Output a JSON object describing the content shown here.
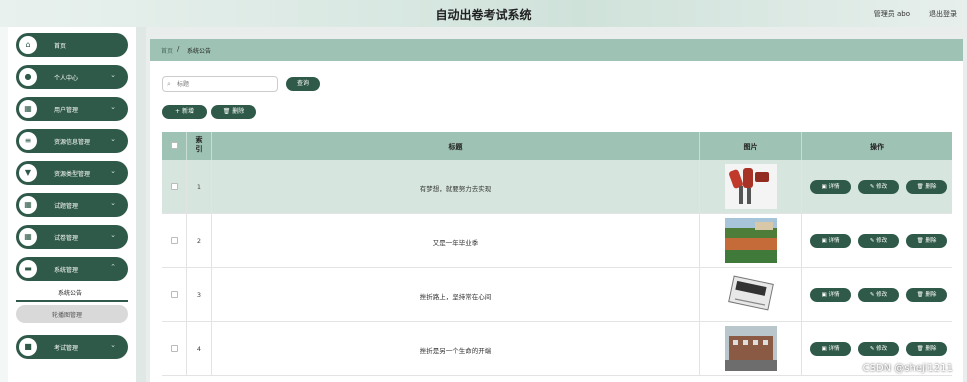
{
  "header": {
    "title": "自动出卷考试系统",
    "admin": "管理员 abo",
    "logout": "退出登录"
  },
  "sidebar": {
    "items": [
      {
        "label": "首页",
        "icon": "home-icon",
        "glyph": "⌂",
        "chevron": ""
      },
      {
        "label": "个人中心",
        "icon": "user-icon",
        "glyph": "●",
        "chevron": "⌄"
      },
      {
        "label": "用户管理",
        "icon": "grid-icon",
        "glyph": "▦",
        "chevron": "⌄"
      },
      {
        "label": "资源信息管理",
        "icon": "list-icon",
        "glyph": "≡",
        "chevron": "⌄"
      },
      {
        "label": "资源类型管理",
        "icon": "filter-icon",
        "glyph": "▼",
        "chevron": "⌄"
      },
      {
        "label": "试题管理",
        "icon": "grid-icon",
        "glyph": "▦",
        "chevron": "⌄"
      },
      {
        "label": "试卷管理",
        "icon": "grid-icon",
        "glyph": "▦",
        "chevron": "⌄"
      },
      {
        "label": "系统管理",
        "icon": "briefcase-icon",
        "glyph": "▬",
        "chevron": "⌃"
      },
      {
        "label": "考试管理",
        "icon": "lock-icon",
        "glyph": "■",
        "chevron": "⌄"
      }
    ],
    "sub_items": [
      "系统公告",
      "轮播图管理"
    ]
  },
  "breadcrumb": {
    "home": "首页",
    "separator": "/",
    "current": "系统公告"
  },
  "search": {
    "placeholder": "标题",
    "value": "",
    "query_label": "查询"
  },
  "toolbar": {
    "add_label": "+ 新增",
    "delete_label": "删除"
  },
  "table": {
    "headers": {
      "index_line1": "索",
      "index_line2": "引",
      "title": "标题",
      "image": "图片",
      "actions": "操作"
    },
    "actions": {
      "detail": "详情",
      "edit": "修改",
      "delete": "删除"
    },
    "rows": [
      {
        "index": "1",
        "title": "有梦想，就要努力去实现",
        "image": "microphones-news-image"
      },
      {
        "index": "2",
        "title": "又是一年毕业季",
        "image": "campus-field-image"
      },
      {
        "index": "3",
        "title": "挫折路上，坚持常在心间",
        "image": "news-paper-image"
      },
      {
        "index": "4",
        "title": "挫折是另一个生命的开端",
        "image": "campus-building-image"
      }
    ]
  },
  "watermark": "CSDN @sheji1211",
  "colors": {
    "primary": "#2f5a49",
    "header_bg": "#9ec3b4",
    "hover_row": "#d6e6df"
  }
}
